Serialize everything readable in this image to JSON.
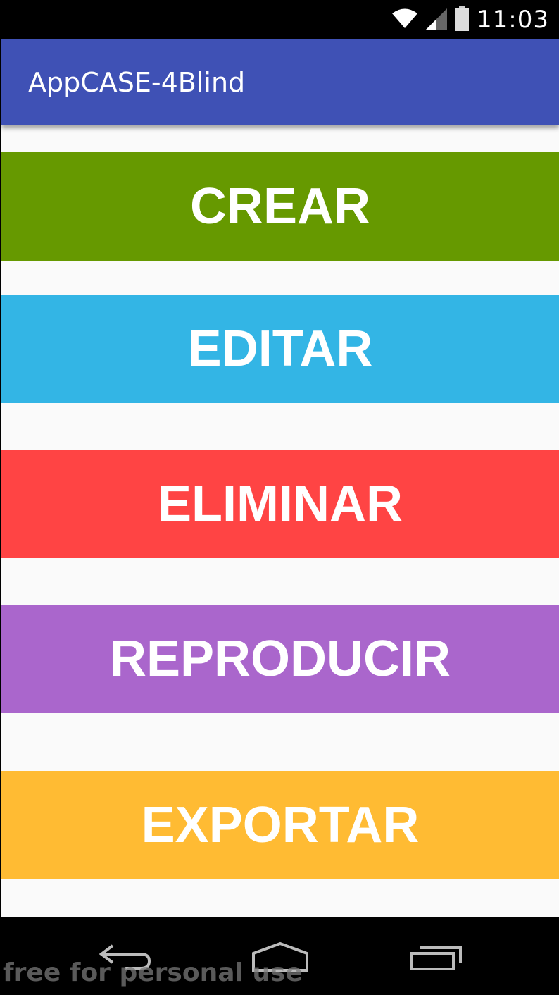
{
  "status_bar": {
    "time": "11:03",
    "icons": [
      "wifi-icon",
      "signal-icon",
      "battery-icon"
    ]
  },
  "app_bar": {
    "title": "AppCASE-4Blind",
    "color": "#3F51B5"
  },
  "menu": {
    "items": [
      {
        "label": "CREAR",
        "color": "#669900"
      },
      {
        "label": "EDITAR",
        "color": "#33B5E5"
      },
      {
        "label": "ELIMINAR",
        "color": "#FF4444"
      },
      {
        "label": "REPRODUCIR",
        "color": "#AA66CC"
      },
      {
        "label": "EXPORTAR",
        "color": "#FFBB33"
      }
    ]
  },
  "nav_bar": {
    "icons": [
      "back-icon",
      "home-icon",
      "recents-icon"
    ]
  },
  "watermark": {
    "text": "free for personal use"
  }
}
